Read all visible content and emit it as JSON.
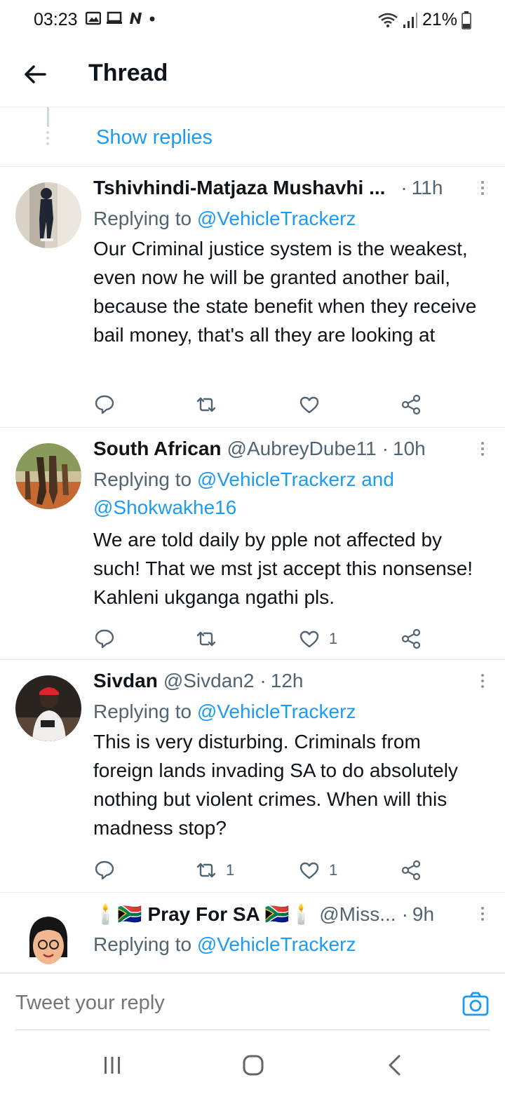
{
  "status_bar": {
    "time": "03:23",
    "battery": "21%",
    "icons": [
      "gallery-icon",
      "cast-icon",
      "n-app-icon",
      "dot-icon",
      "wifi-icon",
      "signal-icon",
      "battery-icon"
    ]
  },
  "header": {
    "title": "Thread"
  },
  "thread": {
    "show_replies": "Show replies",
    "tweets": [
      {
        "name": "Tshivhindi-Matjaza Mushavhi ...",
        "handle": "",
        "dot": "·",
        "time": "11h",
        "replying_prefix": "Replying to ",
        "mentions": "@VehicleTrackerz",
        "text": "Our Criminal justice system is the weakest, even now he will be granted another bail, because the state benefit when they receive bail money, that's all they are looking at",
        "retweets": "",
        "likes": ""
      },
      {
        "name": "South African",
        "handle": "@AubreyDube11",
        "dot": "·",
        "time": "10h",
        "replying_prefix": "Replying to ",
        "mentions": "@VehicleTrackerz and @Shokwakhe16",
        "text": "We are told daily by pple not affected by such! That we mst jst accept this nonsense! Kahleni ukganga ngathi pls.",
        "retweets": "",
        "likes": "1"
      },
      {
        "name": "Sivdan",
        "handle": "@Sivdan2",
        "dot": "·",
        "time": "12h",
        "replying_prefix": "Replying to ",
        "mentions": "@VehicleTrackerz",
        "text": "This is very disturbing.  Criminals from foreign lands invading SA to do absolutely nothing but violent crimes. When will this madness stop?",
        "retweets": "1",
        "likes": "1"
      },
      {
        "name": "🕯️🇿🇦 Pray For SA 🇿🇦🕯️",
        "handle": "@Miss...",
        "dot": "·",
        "time": "9h",
        "replying_prefix": "Replying to ",
        "mentions": "@VehicleTrackerz",
        "text": "",
        "retweets": "",
        "likes": ""
      }
    ]
  },
  "composer": {
    "placeholder": "Tweet your reply"
  },
  "colors": {
    "accent": "#1d9bf0",
    "muted": "#536471",
    "text": "#0f1419",
    "divider": "#e6ecf0"
  }
}
